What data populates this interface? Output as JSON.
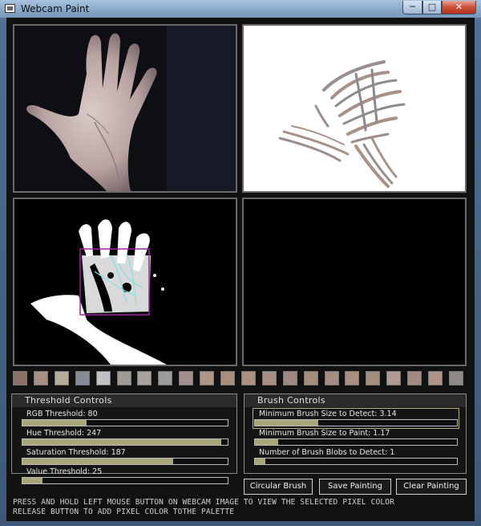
{
  "window": {
    "title": "Webcam Paint",
    "controls": {
      "minimize": "─",
      "maximize": "□",
      "close": "✕"
    }
  },
  "panes": [
    {
      "name": "webcam-view",
      "icon": "camera-feed",
      "bg": "#111111"
    },
    {
      "name": "painting-canvas",
      "bg": "#ffffff"
    },
    {
      "name": "threshold-mask-view",
      "bg": "#000000"
    },
    {
      "name": "brush-preview",
      "bg": "#000000"
    }
  ],
  "palette": [
    "#8a7064",
    "#a89082",
    "#b3ae9a",
    "#8a8b98",
    "#c0c2c6",
    "#9e9a96",
    "#a5a2a0",
    "#9c9c9a",
    "#a48e8e",
    "#b09686",
    "#aa8e7c",
    "#ab9180",
    "#a98f83",
    "#9d8880",
    "#a58d7c",
    "#a48e82",
    "#a88f82",
    "#a58d80",
    "#b09a93",
    "#a38a80",
    "#b09286",
    "#8d8a88"
  ],
  "threshold_controls": {
    "title": "Threshold Controls",
    "sliders": [
      {
        "label": "RGB Threshold: 80",
        "value": 80,
        "max": 255
      },
      {
        "label": "Hue Threshold: 247",
        "value": 247,
        "max": 255
      },
      {
        "label": "Saturation Threshold: 187",
        "value": 187,
        "max": 255
      },
      {
        "label": "Value Threshold: 25",
        "value": 25,
        "max": 255
      }
    ]
  },
  "brush_controls": {
    "title": "Brush Controls",
    "sliders": [
      {
        "label": "Minimum Brush Size to Detect: 3.14",
        "value": 3.14,
        "max": 10
      },
      {
        "label": "Minimum Brush Size to Paint: 1.17",
        "value": 1.17,
        "max": 10
      },
      {
        "label": "Number of Brush Blobs to Detect: 1",
        "value": 1,
        "max": 20
      }
    ]
  },
  "buttons": {
    "circular_brush": "Circular Brush",
    "save_painting": "Save Painting",
    "clear_painting": "Clear Painting"
  },
  "instructions": [
    "PRESS AND HOLD LEFT MOUSE BUTTON ON WEBCAM IMAGE TO VIEW THE SELECTED PIXEL COLOR",
    "RELEASE BUTTON TO ADD PIXEL COLOR TOTHE PALETTE"
  ]
}
